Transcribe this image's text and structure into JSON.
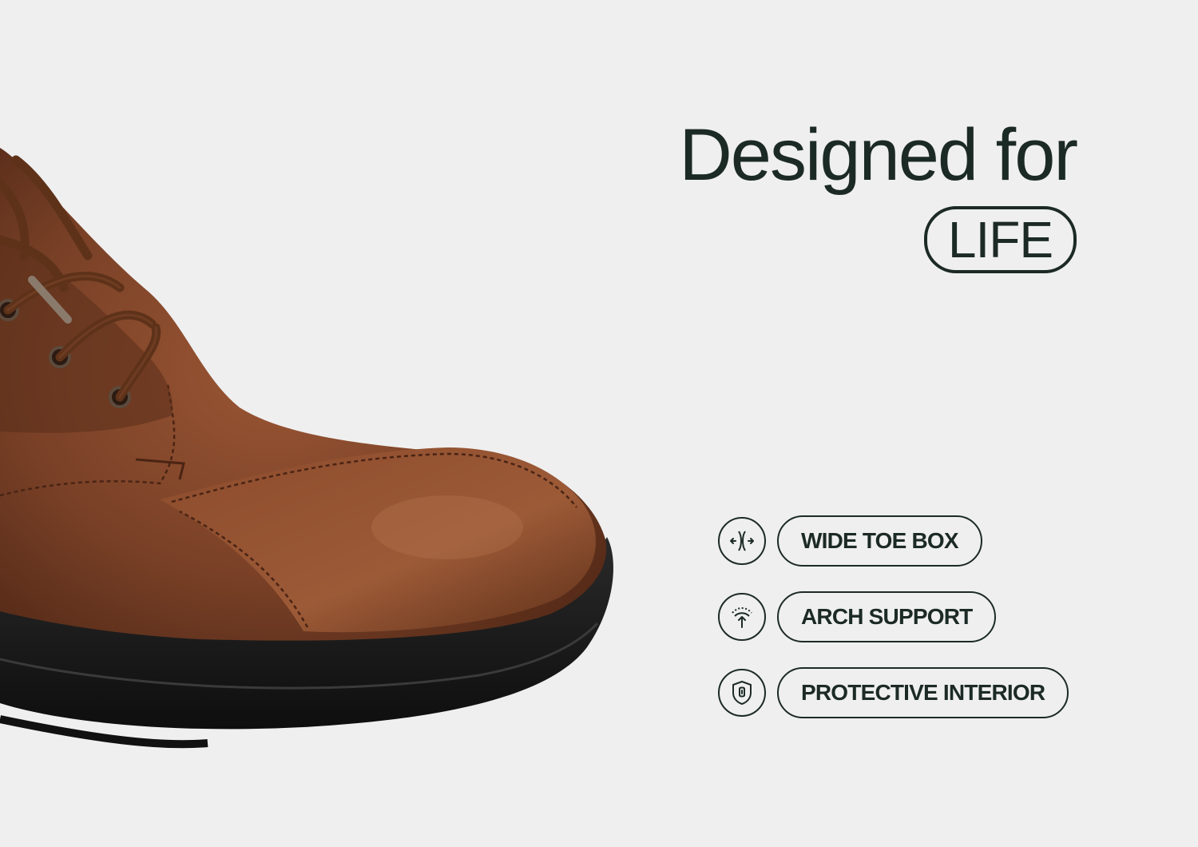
{
  "headline": {
    "line1": "Designed for",
    "pill": "LIFE"
  },
  "features": [
    {
      "icon": "wide-toe-box-icon",
      "label": "WIDE TOE BOX"
    },
    {
      "icon": "arch-support-icon",
      "label": "ARCH SUPPORT"
    },
    {
      "icon": "shield-icon",
      "label": "PROTECTIVE INTERIOR"
    }
  ],
  "colors": {
    "background": "#efefef",
    "ink": "#1c2a26",
    "leather": "#7a4127",
    "sole": "#1a1a1a"
  }
}
